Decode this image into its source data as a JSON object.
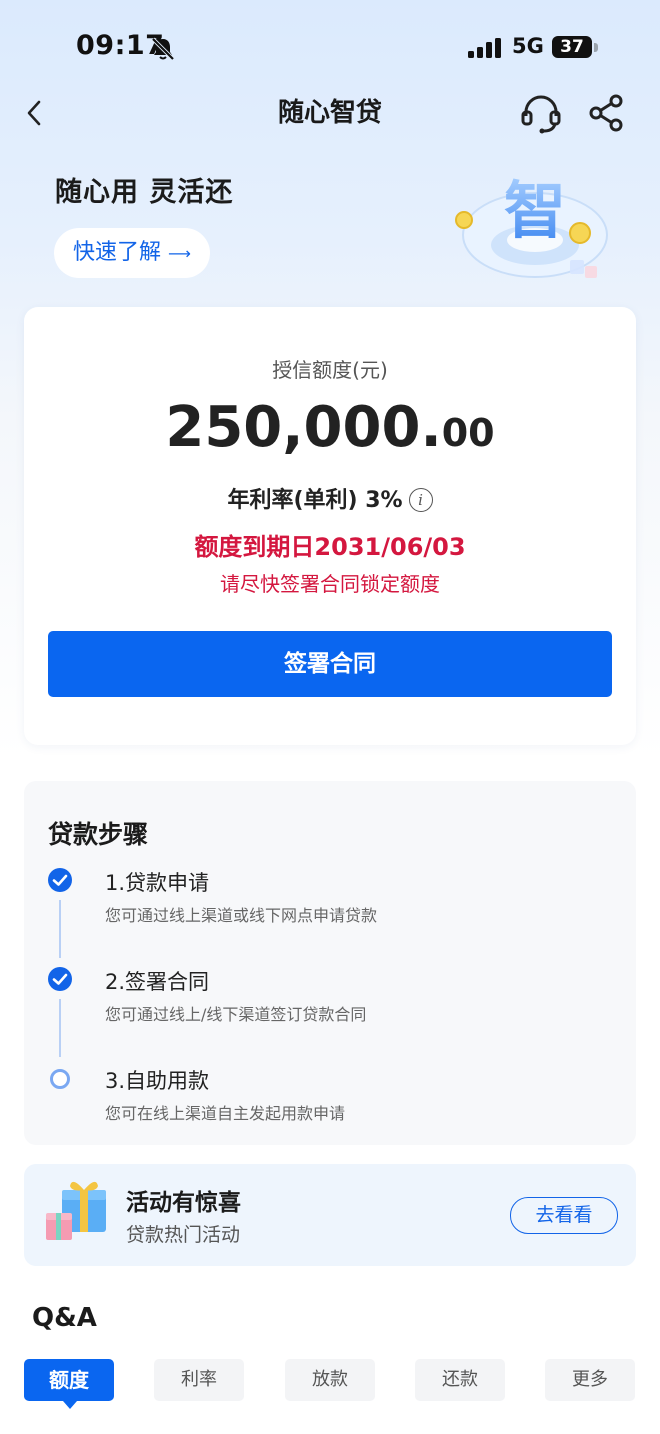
{
  "status_bar": {
    "time": "09:17",
    "network": "5G",
    "battery": "37"
  },
  "nav": {
    "title": "随心智贷"
  },
  "hero": {
    "title": "随心用 灵活还",
    "learn_button": "快速了解",
    "learn_arrow": "⟶",
    "art_char": "智"
  },
  "credit": {
    "label": "授信额度(元)",
    "amount_int": "250,000.",
    "amount_dec": "00",
    "rate": "年利率(单利) 3%",
    "info_glyph": "i",
    "expiry": "额度到期日2031/06/03",
    "reminder": "请尽快签署合同锁定额度",
    "sign_button": "签署合同"
  },
  "steps": {
    "title": "贷款步骤",
    "items": [
      {
        "name": "1.贷款申请",
        "desc": "您可通过线上渠道或线下网点申请贷款",
        "status": "done"
      },
      {
        "name": "2.签署合同",
        "desc": "您可通过线上/线下渠道签订贷款合同",
        "status": "done"
      },
      {
        "name": "3.自助用款",
        "desc": "您可在线上渠道自主发起用款申请",
        "status": "pending"
      }
    ]
  },
  "activity": {
    "title": "活动有惊喜",
    "subtitle": "贷款热门活动",
    "button": "去看看"
  },
  "qa": {
    "title": "Q&A",
    "tabs": [
      "额度",
      "利率",
      "放款",
      "还款",
      "更多"
    ],
    "active_tab": "额度"
  },
  "colors": {
    "primary": "#0a66f0",
    "alert": "#d4173f",
    "background": "#dbeafd"
  },
  "icons": [
    "bell-muted-icon",
    "signal-icon",
    "battery-icon",
    "back-icon",
    "customer-service-icon",
    "share-icon",
    "info-icon",
    "check-icon",
    "gift-icon"
  ]
}
